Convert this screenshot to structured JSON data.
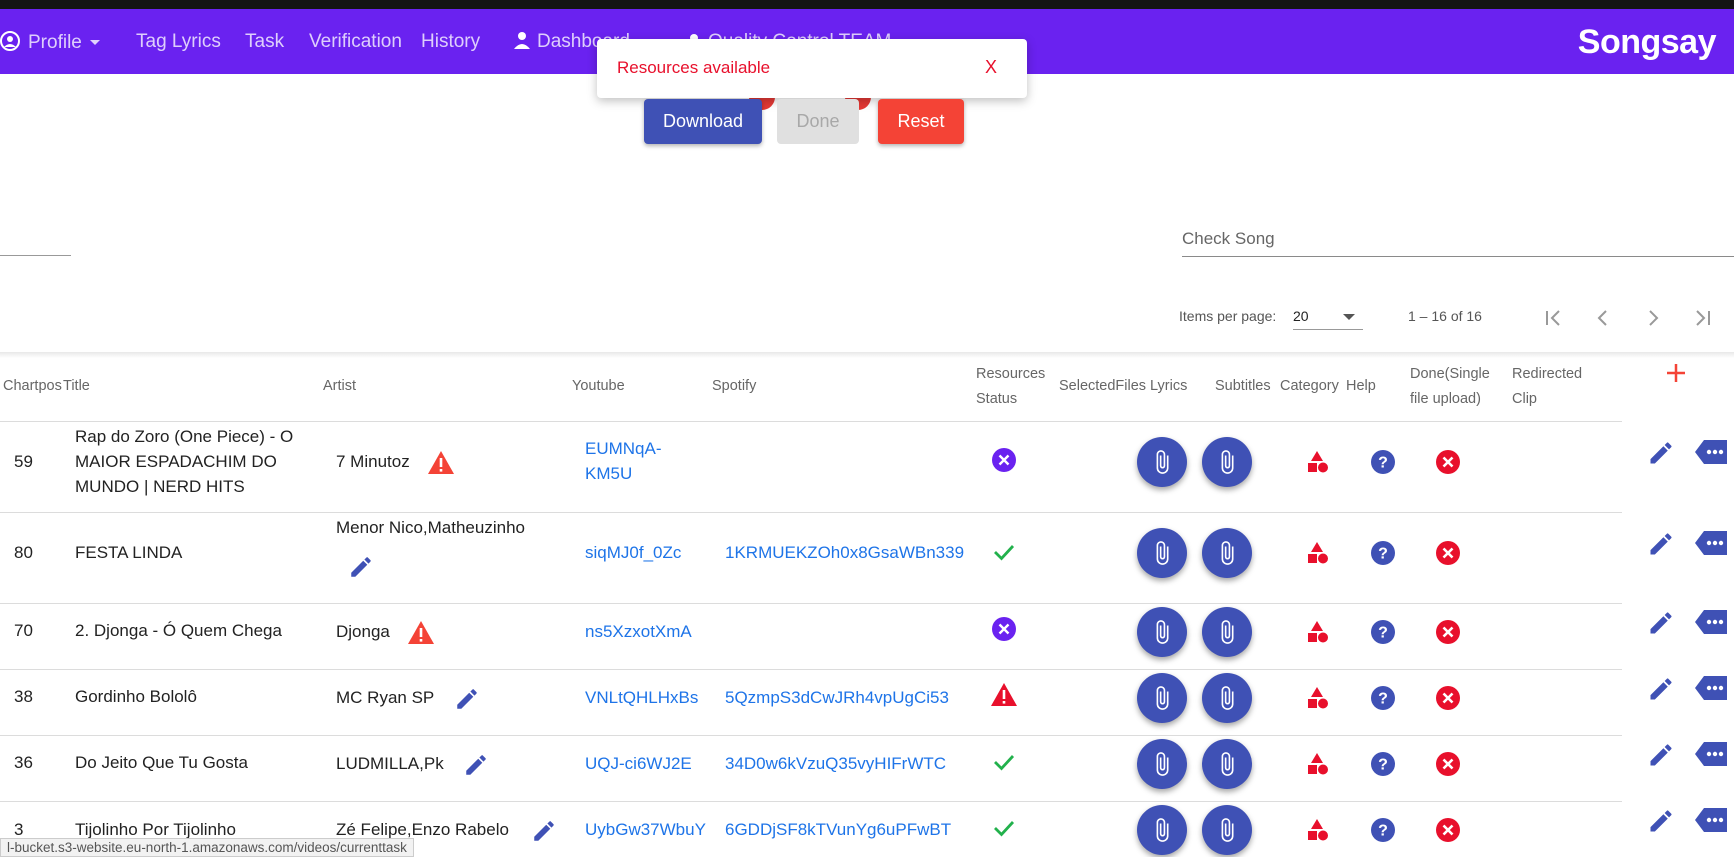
{
  "nav": {
    "items": [
      "Profile",
      "Tag Lyrics",
      "Task",
      "Verification",
      "History",
      "Dashboard",
      "Quality Control TEAM"
    ],
    "brand": "Songsay"
  },
  "toast": {
    "message": "Resources available",
    "close": "X"
  },
  "actions": {
    "download": "Download",
    "done": "Done",
    "reset": "Reset"
  },
  "search": {
    "check_song_placeholder": "Check Song"
  },
  "pagination": {
    "items_per_page_label": "Items per page:",
    "page_size": "20",
    "range": "1 – 16 of 16"
  },
  "table": {
    "headers": {
      "chartpos": "Chartpos",
      "title": "Title",
      "artist": "Artist",
      "youtube": "Youtube",
      "spotify": "Spotify",
      "resources_status": [
        "Resources",
        "Status"
      ],
      "selected_files": "SelectedFiles",
      "lyrics": "Lyrics",
      "subtitles": "Subtitles",
      "category": "Category",
      "help": "Help",
      "done_single": [
        "Done(Single",
        "file upload)"
      ],
      "redirected_clip": [
        "Redirected",
        "Clip"
      ]
    },
    "rows": [
      {
        "chartpos": "59",
        "title_lines": [
          "Rap do Zoro (One Piece) - O",
          "MAIOR ESPADACHIM DO",
          "MUNDO | NERD HITS"
        ],
        "artist": "7 Minutoz",
        "artist_icon": "warning-icon",
        "youtube_lines": [
          "EUMNqA-",
          "KM5U"
        ],
        "spotify": "",
        "status": "unavailable"
      },
      {
        "chartpos": "80",
        "title_lines": [
          "FESTA LINDA"
        ],
        "artist": "Menor Nico,Matheuzinho",
        "artist_icon": "pencil-icon",
        "youtube_lines": [
          "siqMJ0f_0Zc"
        ],
        "spotify": "1KRMUEKZOh0x8GsaWBn339",
        "status": "available"
      },
      {
        "chartpos": "70",
        "title_lines": [
          "2. Djonga - Ó Quem Chega"
        ],
        "artist": "Djonga",
        "artist_icon": "warning-icon",
        "youtube_lines": [
          "ns5XzxotXmA"
        ],
        "spotify": "",
        "status": "unavailable"
      },
      {
        "chartpos": "38",
        "title_lines": [
          "Gordinho Bololô"
        ],
        "artist": "MC Ryan SP",
        "artist_icon": "pencil-icon",
        "youtube_lines": [
          "VNLtQHLHxBs"
        ],
        "spotify": "5QzmpS3dCwJRh4vpUgCi53",
        "status": "warning"
      },
      {
        "chartpos": "36",
        "title_lines": [
          "Do Jeito Que Tu Gosta"
        ],
        "artist": "LUDMILLA,Pk",
        "artist_icon": "pencil-icon",
        "youtube_lines": [
          "UQJ-ci6WJ2E"
        ],
        "spotify": "34D0w6kVzuQ35vyHIFrWTC",
        "status": "available"
      },
      {
        "chartpos": "3",
        "title_lines": [
          "Tijolinho Por Tijolinho"
        ],
        "artist": "Zé Felipe,Enzo Rabelo",
        "artist_icon": "pencil-icon",
        "youtube_lines": [
          "UybGw37WbuY"
        ],
        "spotify": "6GDDjSF8kTVunYg6uPFwBT",
        "status": "available"
      }
    ]
  },
  "status_bar_url": "l-bucket.s3-website.eu-north-1.amazonaws.com/videos/currenttask",
  "colors": {
    "nav": "#6a22f0",
    "primary": "#3f51b5",
    "danger": "#f44336",
    "link": "#1e74e8",
    "success": "#22b14c"
  }
}
